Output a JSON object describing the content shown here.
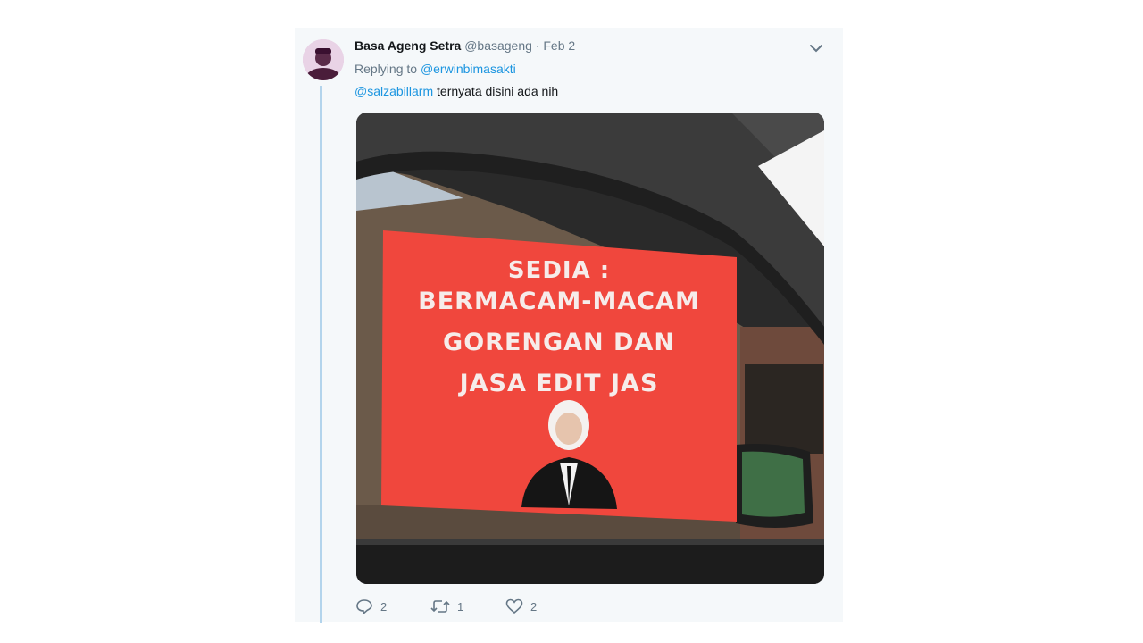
{
  "tweet": {
    "author_name": "Basa Ageng Setra",
    "author_handle": "@basageng",
    "separator": "·",
    "date": "Feb 2",
    "replying_prefix": "Replying to",
    "replying_to": "@erwinbimasakti",
    "mention": "@salzabillarm",
    "text": " ternyata disini ada nih"
  },
  "photo": {
    "sign_lines": [
      "SEDIA :",
      "BERMACAM-MACAM",
      "GORENGAN DAN",
      "JASA EDIT JAS"
    ],
    "sign_color": "#f0473d"
  },
  "actions": {
    "reply_icon": "reply-icon",
    "reply_count": "2",
    "retweet_icon": "retweet-icon",
    "retweet_count": "1",
    "like_icon": "heart-icon",
    "like_count": "2"
  },
  "colors": {
    "link": "#1b95e0",
    "secondary_text": "#657786",
    "thread_line": "#b3d4ec",
    "card_background": "#f5f8fa"
  }
}
